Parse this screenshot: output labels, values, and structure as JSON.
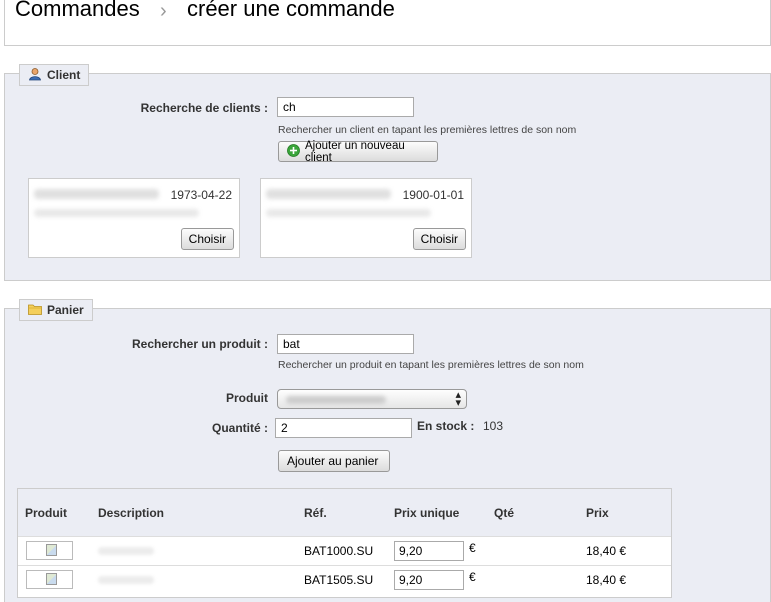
{
  "breadcrumb": {
    "root": "Commandes",
    "separator": "›",
    "current": "créer une commande"
  },
  "client": {
    "legend": "Client",
    "search_label": "Recherche de clients :",
    "search_value": "ch",
    "search_hint": "Rechercher un client en tapant les premières lettres de son nom",
    "add_button": "Ajouter un nouveau client",
    "cards": [
      {
        "date": "1973-04-22",
        "choose": "Choisir"
      },
      {
        "date": "1900-01-01",
        "choose": "Choisir"
      }
    ]
  },
  "cart": {
    "legend": "Panier",
    "product_search_label": "Rechercher un produit :",
    "product_search_value": "bat",
    "product_search_hint": "Rechercher un produit en tapant les premières lettres de son nom",
    "product_label": "Produit",
    "quantity_label": "Quantité :",
    "quantity_value": "2",
    "stock_label": "En stock :",
    "stock_value": "103",
    "add_button": "Ajouter au panier",
    "table": {
      "headers": [
        "Produit",
        "Description",
        "Réf.",
        "Prix unique",
        "Qté",
        "Prix"
      ],
      "rows": [
        {
          "ref": "BAT1000.SU",
          "unit_price": "9,20",
          "currency": "€",
          "price": "18,40 €"
        },
        {
          "ref": "BAT1505.SU",
          "unit_price": "9,20",
          "currency": "€",
          "price": "18,40 €"
        }
      ]
    }
  },
  "colors": {
    "panel_bg": "#ebedf4",
    "border": "#cccccc",
    "add_icon": "#3aa53a"
  }
}
